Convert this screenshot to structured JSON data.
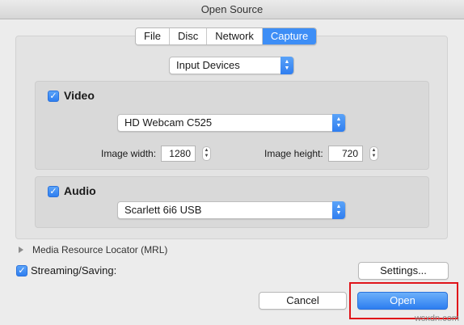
{
  "window": {
    "title": "Open Source"
  },
  "tabs": [
    {
      "label": "File"
    },
    {
      "label": "Disc"
    },
    {
      "label": "Network"
    },
    {
      "label": "Capture"
    }
  ],
  "capture_mode": {
    "value": "Input Devices"
  },
  "video": {
    "label": "Video",
    "checked": true,
    "device": "HD Webcam C525",
    "width_label": "Image width:",
    "width_value": "1280",
    "height_label": "Image height:",
    "height_value": "720"
  },
  "audio": {
    "label": "Audio",
    "checked": true,
    "device": "Scarlett 6i6 USB"
  },
  "mrl": {
    "label": "Media Resource Locator (MRL)"
  },
  "streaming": {
    "label": "Streaming/Saving:",
    "checked": true
  },
  "buttons": {
    "settings": "Settings...",
    "cancel": "Cancel",
    "open": "Open"
  },
  "watermark": "wsxdn.com",
  "colors": {
    "accent": "#3d8ef6",
    "highlight": "#e0141a"
  }
}
